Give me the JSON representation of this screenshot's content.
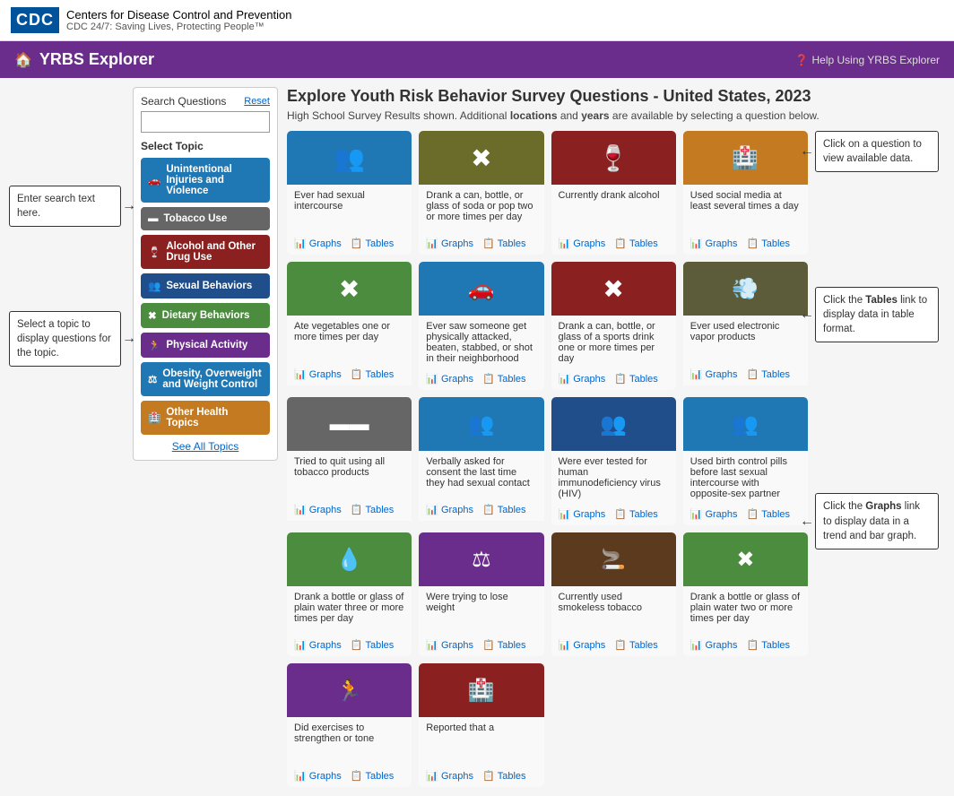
{
  "header": {
    "logo_text": "CDC",
    "org_name": "Centers for Disease Control and Prevention",
    "org_tagline": "CDC 24/7: Saving Lives, Protecting People™"
  },
  "navbar": {
    "title": "YRBS Explorer",
    "help_label": "Help Using YRBS Explorer"
  },
  "sidebar": {
    "search_label": "Search Questions",
    "reset_label": "Reset",
    "search_placeholder": "",
    "select_topic_label": "Select Topic",
    "topics": [
      {
        "id": "unintentional",
        "label": "Unintentional Injuries and Violence",
        "color": "topic-unintentional",
        "icon": "🚗"
      },
      {
        "id": "tobacco",
        "label": "Tobacco Use",
        "color": "topic-tobacco",
        "icon": "🚬"
      },
      {
        "id": "alcohol",
        "label": "Alcohol and Other Drug Use",
        "color": "topic-alcohol",
        "icon": "🍷"
      },
      {
        "id": "sexual",
        "label": "Sexual Behaviors",
        "color": "topic-sexual",
        "icon": "👥"
      },
      {
        "id": "dietary",
        "label": "Dietary Behaviors",
        "color": "topic-dietary",
        "icon": "✖"
      },
      {
        "id": "physical",
        "label": "Physical Activity",
        "color": "topic-physical",
        "icon": "🏃"
      },
      {
        "id": "obesity",
        "label": "Obesity, Overweight and Weight Control",
        "color": "topic-obesity",
        "icon": "⚖"
      },
      {
        "id": "other",
        "label": "Other Health Topics",
        "color": "topic-other",
        "icon": "🏥"
      }
    ],
    "see_all_label": "See All Topics"
  },
  "content": {
    "title": "Explore Youth Risk Behavior Survey Questions - United States, 2023",
    "subtitle_part1": "High School Survey Results shown. Additional ",
    "subtitle_locations": "locations",
    "subtitle_part2": " and ",
    "subtitle_years": "years",
    "subtitle_part3": " are available by selecting a question below.",
    "cards": [
      {
        "color": "color-blue",
        "icon": "👥",
        "text": "Ever had sexual intercourse",
        "graphs_label": "Graphs",
        "tables_label": "Tables"
      },
      {
        "color": "color-olive",
        "icon": "✖",
        "text": "Drank a can, bottle, or glass of soda or pop two or more times per day",
        "graphs_label": "Graphs",
        "tables_label": "Tables"
      },
      {
        "color": "color-dark-red",
        "icon": "🍷",
        "text": "Currently drank alcohol",
        "graphs_label": "Graphs",
        "tables_label": "Tables"
      },
      {
        "color": "color-orange",
        "icon": "🏥",
        "text": "Used social media at least several times a day",
        "graphs_label": "Graphs",
        "tables_label": "Tables"
      },
      {
        "color": "color-green",
        "icon": "✖",
        "text": "Ate vegetables one or more times per day",
        "graphs_label": "Graphs",
        "tables_label": "Tables"
      },
      {
        "color": "color-teal",
        "icon": "🚗",
        "text": "Ever saw someone get physically attacked, beaten, stabbed, or shot in their neighborhood",
        "graphs_label": "Graphs",
        "tables_label": "Tables"
      },
      {
        "color": "color-dark-brown",
        "icon": "🚬",
        "text": "Drank a can, bottle, or glass of a sports drink one or more times per day",
        "graphs_label": "Graphs",
        "tables_label": "Tables"
      },
      {
        "color": "color-gray-green",
        "icon": "💨",
        "text": "Ever used electronic vapor products",
        "graphs_label": "Graphs",
        "tables_label": "Tables"
      },
      {
        "color": "color-dark-olive",
        "icon": "🚬",
        "text": "Tried to quit using all tobacco products",
        "graphs_label": "Graphs",
        "tables_label": "Tables"
      },
      {
        "color": "color-blue",
        "icon": "👥",
        "text": "Verbally asked for consent the last time they had sexual contact",
        "graphs_label": "Graphs",
        "tables_label": "Tables"
      },
      {
        "color": "color-blue",
        "icon": "👥",
        "text": "Were ever tested for human immunodeficiency virus (HIV)",
        "graphs_label": "Graphs",
        "tables_label": "Tables"
      },
      {
        "color": "color-blue",
        "icon": "👥",
        "text": "Used birth control pills before last sexual intercourse with opposite-sex partner",
        "graphs_label": "Graphs",
        "tables_label": "Tables"
      },
      {
        "color": "color-green",
        "icon": "💧",
        "text": "Drank a bottle or glass of plain water three or more times per day",
        "graphs_label": "Graphs",
        "tables_label": "Tables"
      },
      {
        "color": "color-purple",
        "icon": "⚖",
        "text": "Were trying to lose weight",
        "graphs_label": "Graphs",
        "tables_label": "Tables"
      },
      {
        "color": "color-dark-brown",
        "icon": "🚬",
        "text": "Currently used smokeless tobacco",
        "graphs_label": "Graphs",
        "tables_label": "Tables"
      },
      {
        "color": "color-green",
        "icon": "✖",
        "text": "Drank a bottle or glass of plain water two or more times per day",
        "graphs_label": "Graphs",
        "tables_label": "Tables"
      },
      {
        "color": "color-purple",
        "icon": "🏃",
        "text": "Did exercises to strengthen or tone",
        "graphs_label": "Graphs",
        "tables_label": "Tables"
      },
      {
        "color": "color-orange",
        "icon": "🏥",
        "text": "Reported that a",
        "graphs_label": "Graphs",
        "tables_label": "Tables"
      }
    ]
  },
  "annotations": {
    "search_hint": "Enter search text here.",
    "topic_hint": "Select a topic to display questions for the topic.",
    "click_question_hint": "Click on a question to view available data.",
    "tables_hint_pre": "Click the ",
    "tables_hint_bold": "Tables",
    "tables_hint_post": " link to display data in table format.",
    "graphs_hint_pre": "Click the ",
    "graphs_hint_bold": "Graphs",
    "graphs_hint_post": " link to display data in a trend and bar graph."
  }
}
